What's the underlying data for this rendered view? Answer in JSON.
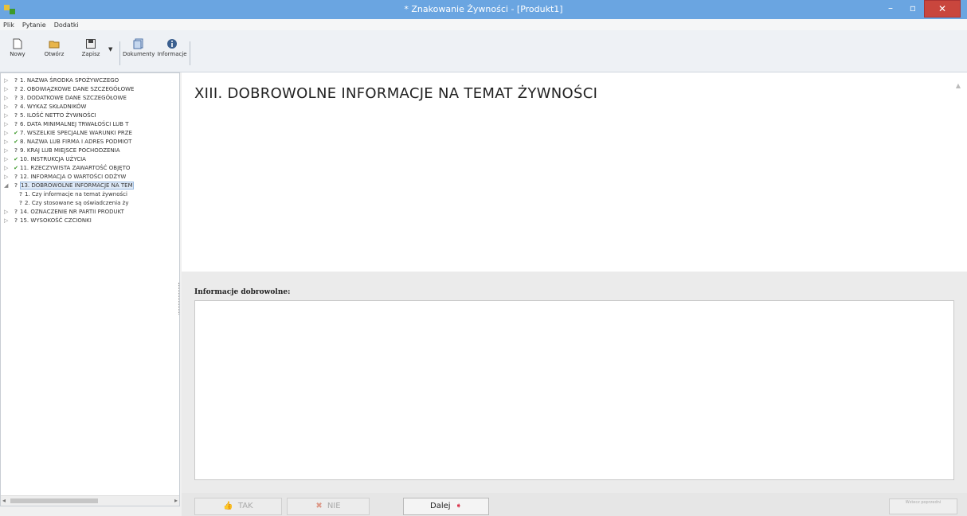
{
  "window": {
    "title": "* Znakowanie Żywności - [Produkt1]",
    "controls": {
      "minimize": "–",
      "maximize": "▫",
      "close": "✕"
    }
  },
  "menu": [
    "Plik",
    "Pytanie",
    "Dodatki"
  ],
  "toolbar": [
    {
      "label": "Nowy",
      "icon": "new-file-icon"
    },
    {
      "label": "Otwórz",
      "icon": "open-folder-icon"
    },
    {
      "label": "Zapisz",
      "icon": "save-icon"
    },
    {
      "label": "Dokumenty",
      "icon": "documents-icon"
    },
    {
      "label": "Informacje",
      "icon": "info-icon"
    }
  ],
  "tree": [
    {
      "label": "1. NAZWA ŚRODKA SPOŻYWCZEGO",
      "status": "?",
      "level": 0
    },
    {
      "label": "2. OBOWIĄZKOWE DANE SZCZEGÓŁOWE",
      "status": "?",
      "level": 0
    },
    {
      "label": "3. DODATKOWE DANE SZCZEGÓŁOWE",
      "status": "?",
      "level": 0
    },
    {
      "label": "4. WYKAZ SKŁADNIKÓW",
      "status": "?",
      "level": 0
    },
    {
      "label": "5. ILOŚĆ NETTO ŻYWNOŚCI",
      "status": "?",
      "level": 0
    },
    {
      "label": "6. DATA MINIMALNEJ TRWAŁOŚCI LUB T",
      "status": "?",
      "level": 0
    },
    {
      "label": "7. WSZELKIE SPECJALNE WARUNKI PRZE",
      "status": "✔",
      "level": 0
    },
    {
      "label": "8. NAZWA LUB FIRMA I ADRES PODMIOT",
      "status": "✔",
      "level": 0
    },
    {
      "label": "9. KRAJ LUB MIEJSCE POCHODZENIA",
      "status": "?",
      "level": 0
    },
    {
      "label": "10. INSTRUKCJA UŻYCIA",
      "status": "✔",
      "level": 0
    },
    {
      "label": "11. RZECZYWISTA ZAWARTOŚĆ OBJĘTO",
      "status": "✔",
      "level": 0
    },
    {
      "label": "12. INFORMACJA O WARTOŚCI ODŻYW",
      "status": "?",
      "level": 0
    },
    {
      "label": "13. DOBROWOLNE INFORMACJE NA TEM",
      "status": "?",
      "level": 0,
      "selected": true
    },
    {
      "label": "1. Czy informacje na temat żywności",
      "status": "?",
      "level": 1
    },
    {
      "label": "2. Czy stosowane są oświadczenia ży",
      "status": "?",
      "level": 1
    },
    {
      "label": "14. OZNACZENIE NR PARTII PRODUKT",
      "status": "?",
      "level": 0
    },
    {
      "label": "15. WYSOKOŚĆ CZCIONKI",
      "status": "?",
      "level": 0
    }
  ],
  "main": {
    "section_title": "XIII. DOBROWOLNE INFORMACJE NA TEMAT ŻYWNOŚCI",
    "field_label": "Informacje dobrowolne:",
    "field_value": ""
  },
  "buttons": {
    "yes": "TAK",
    "no": "NIE",
    "next": "Dalej",
    "small": "Wstecz\npoprzedni"
  },
  "colors": {
    "titlebar": "#6aa5e1",
    "ok_check": "#3d9a2b",
    "next_arrow": "#d9324a"
  }
}
